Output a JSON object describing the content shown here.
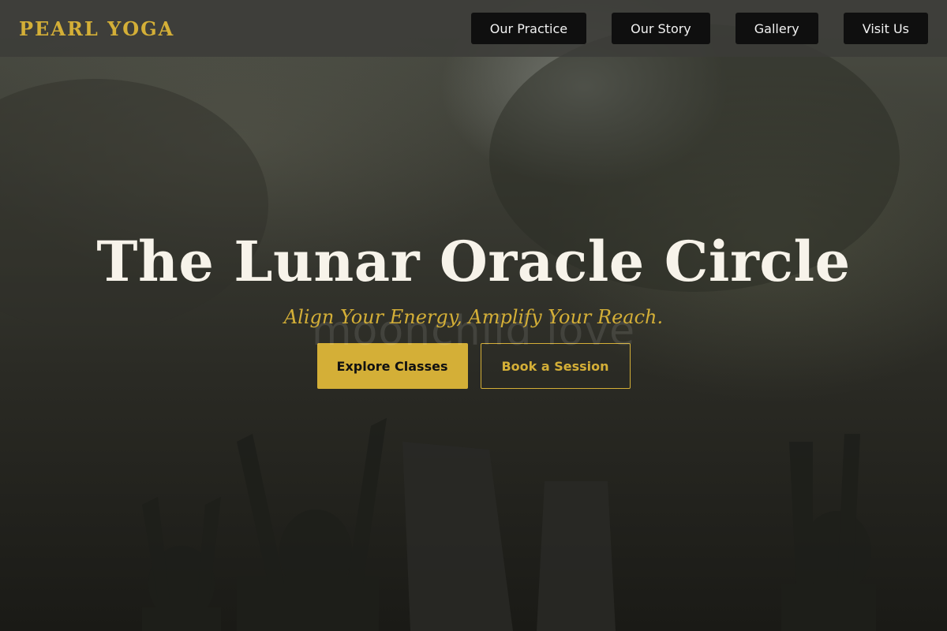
{
  "brand": {
    "name": "PEARL YOGA",
    "accent_color": "#d4af37"
  },
  "nav": {
    "items": [
      {
        "label": "Our Practice"
      },
      {
        "label": "Our Story"
      },
      {
        "label": "Gallery"
      },
      {
        "label": "Visit Us"
      }
    ]
  },
  "hero": {
    "title": "The Lunar Oracle Circle",
    "subtitle": "Align Your Energy, Amplify Your Reach.",
    "watermark": "moonchild love",
    "primary_cta": "Explore Classes",
    "secondary_cta": "Book a Session"
  }
}
